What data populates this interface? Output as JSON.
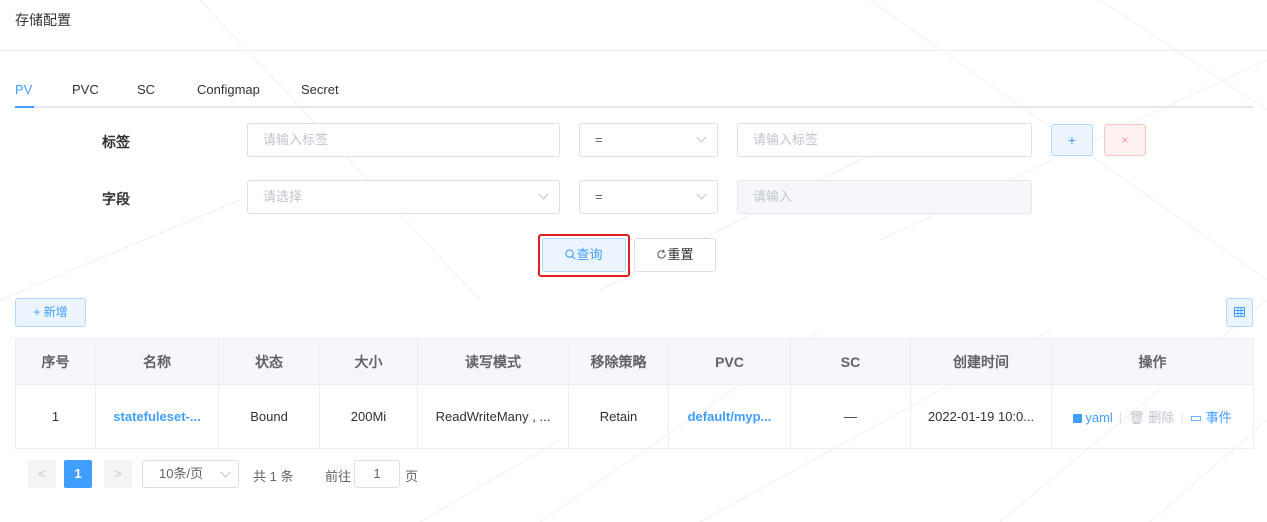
{
  "page": {
    "title": "存储配置"
  },
  "tabs": [
    {
      "label": "PV",
      "active": true
    },
    {
      "label": "PVC",
      "active": false
    },
    {
      "label": "SC",
      "active": false
    },
    {
      "label": "Configmap",
      "active": false
    },
    {
      "label": "Secret",
      "active": false
    }
  ],
  "filters": {
    "label_row": {
      "label": "标签",
      "key_placeholder": "请输入标签",
      "operator": "=",
      "value_placeholder": "请输入标签"
    },
    "field_row": {
      "label": "字段",
      "key_placeholder": "请选择",
      "operator": "=",
      "value_placeholder": "请输入"
    },
    "add_symbol": "+",
    "remove_symbol": "×"
  },
  "buttons": {
    "query": "查询",
    "reset": "重置",
    "add_new": "新增",
    "columns_icon": "⊞"
  },
  "icons": {
    "search": "search-icon",
    "refresh": "refresh-icon",
    "plus": "plus-icon",
    "grid": "grid-icon"
  },
  "table": {
    "columns": [
      "序号",
      "名称",
      "状态",
      "大小",
      "读写模式",
      "移除策略",
      "PVC",
      "SC",
      "创建时间",
      "操作"
    ],
    "rows": [
      {
        "index": "1",
        "name": "statefuleset-...",
        "status": "Bound",
        "size": "200Mi",
        "access_mode": "ReadWriteMany , ...",
        "reclaim_policy": "Retain",
        "pvc": "default/myp...",
        "sc": "—",
        "created": "2022-01-19 10:0...",
        "actions": {
          "yaml": "yaml",
          "delete": "删除",
          "events": "事件"
        }
      }
    ]
  },
  "pagination": {
    "prev": "<",
    "current_page": "1",
    "next": ">",
    "page_size": "10条/页",
    "total": "共 1 条",
    "goto_label": "前往",
    "goto_value": "1",
    "page_suffix": "页"
  },
  "colors": {
    "primary": "#409eff",
    "danger_highlight": "#e02020",
    "header_bg": "#f5f7fa"
  }
}
